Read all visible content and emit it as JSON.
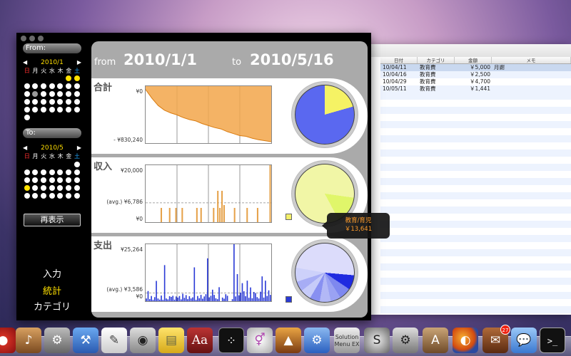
{
  "colors": {
    "accent_yellow": "#ffde00",
    "expense_blue": "#2a3ad6",
    "income_orange": "#e6a24a",
    "pie_blue": "#5a68f0",
    "pie_yellow": "#f5f264"
  },
  "sidebar": {
    "from_label": "From:",
    "to_label": "To:",
    "from_month": "2010/1",
    "to_month": "2010/5",
    "weekdays": [
      "日",
      "月",
      "火",
      "水",
      "木",
      "金",
      "土"
    ],
    "redisplay_label": "再表示",
    "nav": [
      "入力",
      "統計",
      "カテゴリ"
    ]
  },
  "header": {
    "from_word": "from",
    "from_date": "2010/1/1",
    "to_word": "to",
    "to_date": "2010/5/16"
  },
  "sections": {
    "total": {
      "title": "合計",
      "y_top": "¥0",
      "y_bottom": "- ¥830,240"
    },
    "income": {
      "title": "収入",
      "y_top": "¥20,000",
      "y_avg": "(avg.) ¥6,786",
      "y_bottom": "¥0"
    },
    "expense": {
      "title": "支出",
      "y_top": "¥25,264",
      "y_avg": "(avg.) ¥3,586",
      "y_bottom": "¥0"
    }
  },
  "tooltip": {
    "category": "教育/育児",
    "amount": "￥13,641"
  },
  "list": {
    "columns": [
      "日付",
      "カテゴリ",
      "金額",
      "メモ"
    ],
    "rows": [
      {
        "date": "10/04/11",
        "category": "教育費",
        "amount": "￥5,000",
        "memo": "月謝"
      },
      {
        "date": "10/04/16",
        "category": "教育費",
        "amount": "￥2,500",
        "memo": ""
      },
      {
        "date": "10/04/29",
        "category": "教育費",
        "amount": "￥4,700",
        "memo": ""
      },
      {
        "date": "10/05/11",
        "category": "教育費",
        "amount": "￥1,441",
        "memo": ""
      }
    ]
  },
  "dock": {
    "mail_badge": "27",
    "dictionary_label": "Aa"
  },
  "chart_data": [
    {
      "type": "area",
      "title": "合計",
      "ylim": [
        -830240,
        0
      ],
      "x": [
        0,
        1,
        2,
        3,
        4,
        5,
        6,
        7,
        8,
        9,
        10,
        11,
        12,
        13,
        14,
        15,
        16,
        17,
        18,
        19,
        20
      ],
      "values": [
        -50000,
        -180000,
        -290000,
        -360000,
        -400000,
        -430000,
        -470000,
        -500000,
        -520000,
        -560000,
        -590000,
        -620000,
        -640000,
        -680000,
        -710000,
        -740000,
        -750000,
        -780000,
        -800000,
        -815000,
        -830240
      ]
    },
    {
      "type": "bar",
      "title": "収入",
      "ylim": [
        0,
        20000
      ],
      "average": 6786,
      "values": [
        0,
        0,
        0,
        0,
        0,
        0,
        0,
        5000,
        0,
        0,
        0,
        5000,
        0,
        0,
        5000,
        0,
        0,
        5000,
        0,
        0,
        0,
        0,
        0,
        0,
        5000,
        0,
        5000,
        0,
        0,
        0,
        0,
        0,
        5000,
        0,
        11000,
        5000,
        11000,
        6000,
        0,
        0,
        0,
        0,
        5000,
        0,
        0,
        0,
        0,
        0,
        5000,
        0,
        0,
        0,
        0,
        5000,
        0,
        0,
        0,
        0,
        0,
        20000
      ]
    },
    {
      "type": "bar",
      "title": "支出",
      "ylim": [
        0,
        25264
      ],
      "average": 3586,
      "values": [
        1200,
        4500,
        900,
        2300,
        600,
        1800,
        9000,
        1200,
        700,
        2500,
        600,
        16000,
        1200,
        800,
        2200,
        1900,
        2400,
        700,
        2100,
        1600,
        2300,
        800,
        3300,
        1500,
        2700,
        900,
        2200,
        1200,
        1700,
        15000,
        600,
        2300,
        1300,
        2800,
        1100,
        2100,
        3100,
        19000,
        1700,
        2400,
        5100,
        2800,
        1300,
        900,
        6200,
        0,
        1600,
        1100,
        3100,
        2400,
        0,
        0,
        900,
        25264,
        2100,
        12000,
        2600,
        3800,
        8000,
        4400,
        2200,
        9100,
        1500,
        6100,
        1300,
        4100,
        3600,
        1800,
        1200,
        4200,
        11000,
        1600,
        9100,
        2300,
        4800,
        2800
      ]
    }
  ]
}
